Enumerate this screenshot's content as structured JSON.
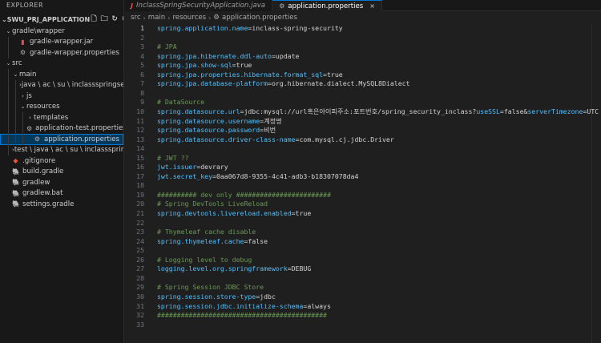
{
  "explorer": {
    "title": "EXPLORER",
    "project": "SWU_PRJ_APPLICATION",
    "tree": [
      {
        "label": "gradle\\wrapper",
        "depth": 0,
        "twisty": "v",
        "icon": "folder-open-icon",
        "glyph": ""
      },
      {
        "label": "gradle-wrapper.jar",
        "depth": 1,
        "twisty": "",
        "icon": "jar-file-icon",
        "glyph": "▮",
        "color": "#e05252"
      },
      {
        "label": "gradle-wrapper.properties",
        "depth": 1,
        "twisty": "",
        "icon": "gear-icon",
        "glyph": "⚙",
        "color": "#b0b0b0"
      },
      {
        "label": "src",
        "depth": 0,
        "twisty": "v",
        "icon": "folder-open-icon",
        "glyph": ""
      },
      {
        "label": "main",
        "depth": 1,
        "twisty": "v",
        "icon": "folder-open-icon",
        "glyph": ""
      },
      {
        "label": "java \\ ac \\ su \\ inclassspringsecurity",
        "depth": 2,
        "twisty": ">",
        "icon": "folder-closed-icon",
        "glyph": ""
      },
      {
        "label": "js",
        "depth": 2,
        "twisty": ">",
        "icon": "folder-closed-icon",
        "glyph": ""
      },
      {
        "label": "resources",
        "depth": 2,
        "twisty": "v",
        "icon": "folder-open-icon",
        "glyph": ""
      },
      {
        "label": "templates",
        "depth": 3,
        "twisty": ">",
        "icon": "folder-closed-icon",
        "glyph": ""
      },
      {
        "label": "application-test.properties",
        "depth": 3,
        "twisty": "",
        "icon": "gear-icon",
        "glyph": "⚙",
        "color": "#b0b0b0"
      },
      {
        "label": "application.properties",
        "depth": 3,
        "twisty": "",
        "icon": "gear-icon",
        "glyph": "⚙",
        "color": "#b0b0b0",
        "selected": true
      },
      {
        "label": "test \\ java \\ ac \\ su \\ inclassspringsec...",
        "depth": 1,
        "twisty": ">",
        "icon": "folder-closed-icon",
        "glyph": ""
      },
      {
        "label": ".gitignore",
        "depth": 0,
        "twisty": "",
        "icon": "git-icon",
        "glyph": "◆",
        "color": "#f05033"
      },
      {
        "label": "build.gradle",
        "depth": 0,
        "twisty": "",
        "icon": "gradle-icon",
        "glyph": "🐘",
        "color": "#5fa8d3"
      },
      {
        "label": "gradlew",
        "depth": 0,
        "twisty": "",
        "icon": "gradle-icon",
        "glyph": "🐘",
        "color": "#5fa8d3"
      },
      {
        "label": "gradlew.bat",
        "depth": 0,
        "twisty": "",
        "icon": "gradle-icon",
        "glyph": "🐘",
        "color": "#5fa8d3"
      },
      {
        "label": "settings.gradle",
        "depth": 0,
        "twisty": "",
        "icon": "gradle-icon",
        "glyph": "🐘",
        "color": "#5fa8d3"
      }
    ]
  },
  "tabs": [
    {
      "label": "InclassSpringSecurityApplication.java",
      "icon": "J",
      "active": false
    },
    {
      "label": "application.properties",
      "icon": "⚙",
      "active": true,
      "close": "×"
    }
  ],
  "breadcrumb": [
    "src",
    "main",
    "resources",
    "application.properties"
  ],
  "editor": {
    "current_line": 1,
    "lines": [
      {
        "n": "1",
        "segs": [
          [
            "k",
            "spring.application.name"
          ],
          [
            "p",
            "="
          ],
          [
            "v",
            "inclass-spring-security"
          ]
        ]
      },
      {
        "n": "2",
        "segs": []
      },
      {
        "n": "3",
        "segs": [
          [
            "c",
            "# JPA"
          ]
        ]
      },
      {
        "n": "4",
        "segs": [
          [
            "k",
            "spring.jpa.hibernate.ddl-auto"
          ],
          [
            "p",
            "="
          ],
          [
            "v",
            "update"
          ]
        ]
      },
      {
        "n": "5",
        "segs": [
          [
            "k",
            "spring.jpa.show-sql"
          ],
          [
            "p",
            "="
          ],
          [
            "v",
            "true"
          ]
        ]
      },
      {
        "n": "6",
        "segs": [
          [
            "k",
            "spring.jpa.properties.hibernate.format_sql"
          ],
          [
            "p",
            "="
          ],
          [
            "v",
            "true"
          ]
        ]
      },
      {
        "n": "7",
        "segs": [
          [
            "k",
            "spring.jpa.database-platform"
          ],
          [
            "p",
            "="
          ],
          [
            "v",
            "org.hibernate.dialect.MySQL8Dialect"
          ]
        ]
      },
      {
        "n": "8",
        "segs": []
      },
      {
        "n": "9",
        "segs": [
          [
            "c",
            "# DataSource"
          ]
        ]
      },
      {
        "n": "10",
        "segs": [
          [
            "k",
            "spring.datasource.url"
          ],
          [
            "p",
            "="
          ],
          [
            "v",
            "jdbc:mysql://url혹은아이피주소:포트번호/spring_security_inclass?"
          ],
          [
            "k",
            "useSSL"
          ],
          [
            "p",
            "="
          ],
          [
            "v",
            "false&"
          ],
          [
            "k",
            "serverTimezone"
          ],
          [
            "p",
            "="
          ],
          [
            "v",
            "UTC"
          ]
        ]
      },
      {
        "n": "11",
        "segs": [
          [
            "k",
            "spring.datasource.username"
          ],
          [
            "p",
            "="
          ],
          [
            "v",
            "계정명"
          ]
        ]
      },
      {
        "n": "12",
        "segs": [
          [
            "k",
            "spring.datasource.password"
          ],
          [
            "p",
            "="
          ],
          [
            "v",
            "비번"
          ]
        ]
      },
      {
        "n": "13",
        "segs": [
          [
            "k",
            "spring.datasource.driver-class-name"
          ],
          [
            "p",
            "="
          ],
          [
            "v",
            "com.mysql.cj.jdbc.Driver"
          ]
        ]
      },
      {
        "n": "14",
        "segs": []
      },
      {
        "n": "15",
        "segs": [
          [
            "c",
            "# JWT ??"
          ]
        ]
      },
      {
        "n": "16",
        "segs": [
          [
            "k",
            "jwt.issuer"
          ],
          [
            "p",
            "="
          ],
          [
            "v",
            "devrary"
          ]
        ]
      },
      {
        "n": "17",
        "segs": [
          [
            "k",
            "jwt.secret_key"
          ],
          [
            "p",
            "="
          ],
          [
            "v",
            "0aa067d8-9355-4c41-adb3-b18307078da4"
          ]
        ]
      },
      {
        "n": "18",
        "segs": []
      },
      {
        "n": "19",
        "segs": [
          [
            "c",
            "########## dev only ########################"
          ]
        ]
      },
      {
        "n": "20",
        "segs": [
          [
            "c",
            "# Spring DevTools LiveReload"
          ]
        ]
      },
      {
        "n": "21",
        "segs": [
          [
            "k",
            "spring.devtools.livereload.enabled"
          ],
          [
            "p",
            "="
          ],
          [
            "v",
            "true"
          ]
        ]
      },
      {
        "n": "22",
        "segs": []
      },
      {
        "n": "23",
        "segs": [
          [
            "c",
            "# Thymeleaf cache disable"
          ]
        ]
      },
      {
        "n": "24",
        "segs": [
          [
            "k",
            "spring.thymeleaf.cache"
          ],
          [
            "p",
            "="
          ],
          [
            "v",
            "false"
          ]
        ]
      },
      {
        "n": "25",
        "segs": []
      },
      {
        "n": "26",
        "segs": [
          [
            "c",
            "# Logging level to debug"
          ]
        ]
      },
      {
        "n": "27",
        "segs": [
          [
            "k",
            "logging.level.org.springframework"
          ],
          [
            "p",
            "="
          ],
          [
            "v",
            "DEBUG"
          ]
        ]
      },
      {
        "n": "28",
        "segs": []
      },
      {
        "n": "29",
        "segs": [
          [
            "c",
            "# Spring Session JDBC Store"
          ]
        ]
      },
      {
        "n": "30",
        "segs": [
          [
            "k",
            "spring.session.store-type"
          ],
          [
            "p",
            "="
          ],
          [
            "v",
            "jdbc"
          ]
        ]
      },
      {
        "n": "31",
        "segs": [
          [
            "k",
            "spring.session.jdbc.initialize-schema"
          ],
          [
            "p",
            "="
          ],
          [
            "v",
            "always"
          ]
        ]
      },
      {
        "n": "32",
        "segs": [
          [
            "c",
            "###########################################"
          ]
        ]
      },
      {
        "n": "33",
        "segs": []
      }
    ]
  }
}
